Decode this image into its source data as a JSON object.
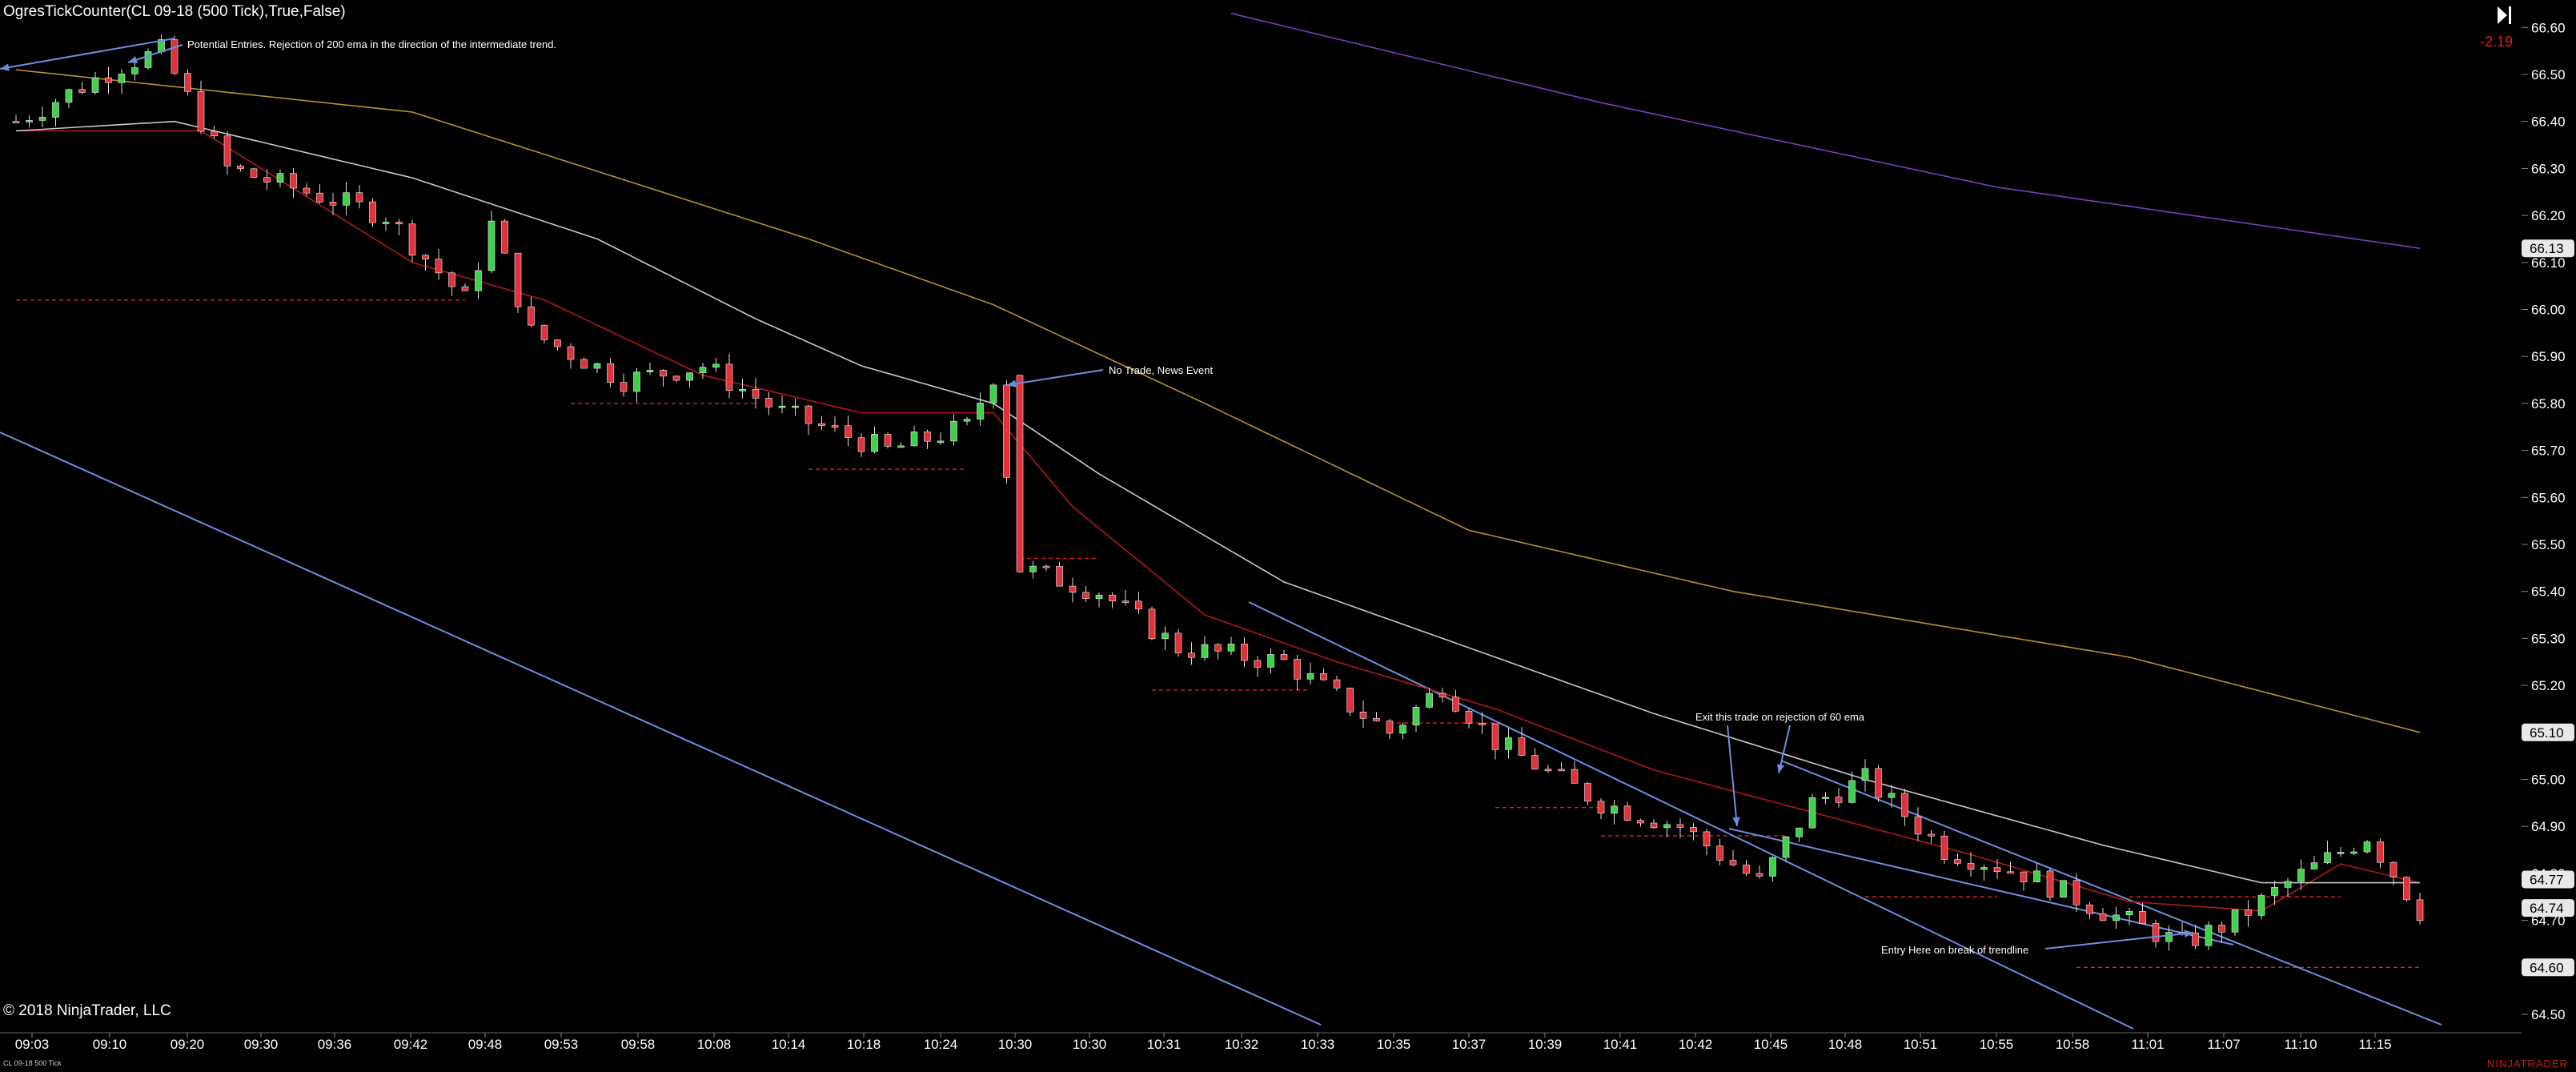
{
  "header": {
    "title": "OgresTickCounter(CL 09-18 (500 Tick),True,False)",
    "pnl": "-2.19"
  },
  "footer": {
    "copyright": "© 2018 NinjaTrader, LLC",
    "signature": "CL 09-18 500 Tick",
    "brand": "NINJATRADER"
  },
  "colors": {
    "background": "#000000",
    "up_candle": "#3cd24a",
    "down_candle": "#e0323a",
    "ema_fast": "#b01818",
    "ema_60": "#c8c8c8",
    "ema_200": "#b8902c",
    "ema_slow": "#7a3fbf",
    "trendline": "#6d8ee0",
    "support": "#e02020"
  },
  "chart_data": {
    "type": "candlestick",
    "x_tick_labels": [
      "09:03",
      "09:10",
      "09:20",
      "09:30",
      "09:36",
      "09:42",
      "09:48",
      "09:53",
      "09:58",
      "10:08",
      "10:14",
      "10:18",
      "10:24",
      "10:30",
      "10:30",
      "10:31",
      "10:32",
      "10:33",
      "10:35",
      "10:37",
      "10:39",
      "10:41",
      "10:42",
      "10:45",
      "10:48",
      "10:51",
      "10:55",
      "10:58",
      "11:01",
      "11:07",
      "11:10",
      "11:15"
    ],
    "y_tick_labels": [
      "66.60",
      "66.50",
      "66.40",
      "66.30",
      "66.20",
      "66.10",
      "66.00",
      "65.90",
      "65.80",
      "65.70",
      "65.60",
      "65.50",
      "65.40",
      "65.30",
      "65.20",
      "65.10",
      "65.00",
      "64.90",
      "64.80",
      "64.70",
      "64.60",
      "64.50"
    ],
    "ylim": [
      64.47,
      66.63
    ],
    "price_labels": [
      "66.13",
      "65.10",
      "64.77",
      "64.74",
      "64.60"
    ],
    "close_path": [
      [
        0,
        66.4
      ],
      [
        8,
        66.52
      ],
      [
        11,
        66.55
      ],
      [
        16,
        66.3
      ],
      [
        28,
        66.2
      ],
      [
        34,
        66.02
      ],
      [
        36,
        66.18
      ],
      [
        39,
        65.95
      ],
      [
        46,
        65.85
      ],
      [
        52,
        65.88
      ],
      [
        58,
        65.78
      ],
      [
        66,
        65.7
      ],
      [
        72,
        65.75
      ],
      [
        74,
        65.86
      ],
      [
        76,
        65.45
      ],
      [
        82,
        65.4
      ],
      [
        88,
        65.28
      ],
      [
        96,
        65.25
      ],
      [
        104,
        65.1
      ],
      [
        108,
        65.2
      ],
      [
        112,
        65.08
      ],
      [
        120,
        64.95
      ],
      [
        126,
        64.9
      ],
      [
        132,
        64.78
      ],
      [
        136,
        64.95
      ],
      [
        140,
        65.0
      ],
      [
        146,
        64.85
      ],
      [
        152,
        64.8
      ],
      [
        158,
        64.72
      ],
      [
        164,
        64.65
      ],
      [
        168,
        64.7
      ],
      [
        172,
        64.78
      ],
      [
        178,
        64.88
      ],
      [
        182,
        64.72
      ]
    ],
    "series": [
      {
        "name": "EMA fast",
        "values": [
          [
            0,
            66.38
          ],
          [
            14,
            66.38
          ],
          [
            30,
            66.1
          ],
          [
            40,
            66.02
          ],
          [
            52,
            65.86
          ],
          [
            64,
            65.78
          ],
          [
            74,
            65.78
          ],
          [
            80,
            65.58
          ],
          [
            90,
            65.35
          ],
          [
            100,
            65.25
          ],
          [
            112,
            65.15
          ],
          [
            124,
            65.02
          ],
          [
            136,
            64.93
          ],
          [
            148,
            64.84
          ],
          [
            160,
            64.74
          ],
          [
            170,
            64.72
          ],
          [
            176,
            64.82
          ],
          [
            182,
            64.78
          ]
        ]
      },
      {
        "name": "EMA 60",
        "values": [
          [
            0,
            66.38
          ],
          [
            12,
            66.4
          ],
          [
            30,
            66.28
          ],
          [
            44,
            66.15
          ],
          [
            56,
            65.98
          ],
          [
            64,
            65.88
          ],
          [
            74,
            65.8
          ],
          [
            82,
            65.65
          ],
          [
            96,
            65.42
          ],
          [
            110,
            65.28
          ],
          [
            124,
            65.14
          ],
          [
            140,
            65.0
          ],
          [
            158,
            64.86
          ],
          [
            170,
            64.78
          ],
          [
            182,
            64.78
          ]
        ]
      },
      {
        "name": "EMA 200",
        "values": [
          [
            0,
            66.51
          ],
          [
            30,
            66.42
          ],
          [
            60,
            66.15
          ],
          [
            74,
            66.01
          ],
          [
            90,
            65.8
          ],
          [
            110,
            65.53
          ],
          [
            130,
            65.4
          ],
          [
            160,
            65.26
          ],
          [
            182,
            65.1
          ]
        ]
      },
      {
        "name": "EMA slow",
        "values": [
          [
            92,
            66.63
          ],
          [
            120,
            66.44
          ],
          [
            150,
            66.26
          ],
          [
            182,
            66.13
          ]
        ]
      }
    ],
    "annotations": [
      {
        "text": "Potential Entries. Rejection of 200 ema in the direction of the intermediate trend."
      },
      {
        "text": "No Trade, News Event"
      },
      {
        "text": "Exit this trade on rejection of 60 ema"
      },
      {
        "text": "Entry Here on break of trendline"
      }
    ]
  }
}
